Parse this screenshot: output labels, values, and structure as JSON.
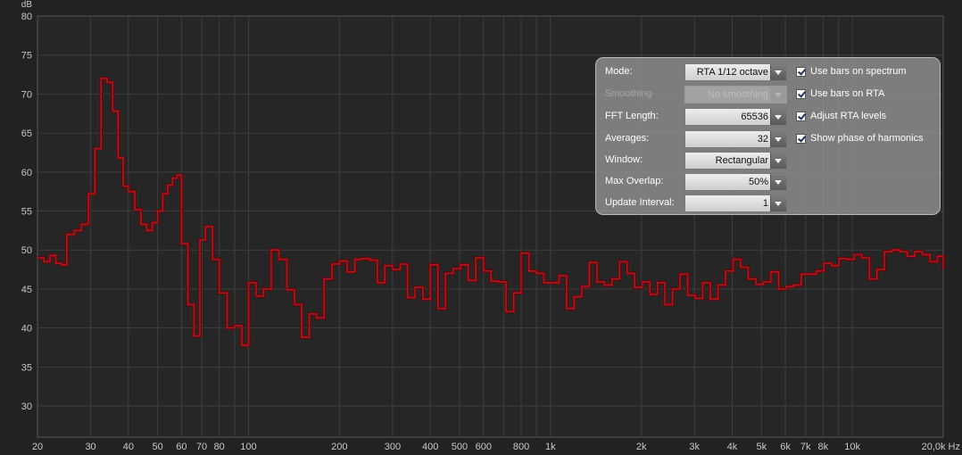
{
  "chart_data": {
    "type": "line",
    "ylabel": "dB",
    "xunit": "Hz",
    "xscale": "log",
    "xlim": [
      20,
      20000
    ],
    "ylim": [
      26,
      80
    ],
    "grid": true,
    "yticks": [
      "30",
      "35",
      "40",
      "45",
      "50",
      "55",
      "60",
      "65",
      "70",
      "75",
      "80"
    ],
    "xticks": [
      {
        "v": 20,
        "label": "20"
      },
      {
        "v": 30,
        "label": "30"
      },
      {
        "v": 40,
        "label": "40"
      },
      {
        "v": 50,
        "label": "50"
      },
      {
        "v": 60,
        "label": "60"
      },
      {
        "v": 70,
        "label": "70"
      },
      {
        "v": 80,
        "label": "80"
      },
      {
        "v": 100,
        "label": "100"
      },
      {
        "v": 200,
        "label": "200"
      },
      {
        "v": 300,
        "label": "300"
      },
      {
        "v": 400,
        "label": "400"
      },
      {
        "v": 500,
        "label": "500"
      },
      {
        "v": 600,
        "label": "600"
      },
      {
        "v": 800,
        "label": "800"
      },
      {
        "v": 1000,
        "label": "1k"
      },
      {
        "v": 2000,
        "label": "2k"
      },
      {
        "v": 3000,
        "label": "3k"
      },
      {
        "v": 4000,
        "label": "4k"
      },
      {
        "v": 5000,
        "label": "5k"
      },
      {
        "v": 6000,
        "label": "6k"
      },
      {
        "v": 7000,
        "label": "7k"
      },
      {
        "v": 8000,
        "label": "8k"
      },
      {
        "v": 10000,
        "label": "10k"
      },
      {
        "v": 20000,
        "label": "20,0k Hz"
      }
    ],
    "series": [
      {
        "color": "#b2161c",
        "points": [
          [
            20,
            49.0
          ],
          [
            21,
            48.5
          ],
          [
            22,
            49.3
          ],
          [
            23,
            48.3
          ],
          [
            24,
            48.1
          ],
          [
            25,
            52.0
          ],
          [
            26.5,
            52.5
          ],
          [
            28,
            53.3
          ],
          [
            29.5,
            57.2
          ],
          [
            31,
            63.0
          ],
          [
            32.5,
            72.0
          ],
          [
            34,
            71.5
          ],
          [
            35.5,
            67.8
          ],
          [
            37,
            61.8
          ],
          [
            38.5,
            58.2
          ],
          [
            40,
            57.5
          ],
          [
            42,
            55.2
          ],
          [
            44,
            53.3
          ],
          [
            46,
            52.5
          ],
          [
            48,
            53.5
          ],
          [
            50,
            55.0
          ],
          [
            52,
            57.2
          ],
          [
            54,
            58.3
          ],
          [
            56,
            59.2
          ],
          [
            58,
            59.6
          ],
          [
            60,
            50.8
          ],
          [
            63,
            43.0
          ],
          [
            66,
            39.0
          ],
          [
            69,
            51.3
          ],
          [
            72,
            53.0
          ],
          [
            76,
            48.8
          ],
          [
            80,
            44.5
          ],
          [
            85,
            40.0
          ],
          [
            90,
            40.3
          ],
          [
            95,
            37.8
          ],
          [
            100,
            45.8
          ],
          [
            106,
            44.1
          ],
          [
            112,
            45.0
          ],
          [
            119,
            50.0
          ],
          [
            126,
            48.8
          ],
          [
            134,
            44.9
          ],
          [
            142,
            43.0
          ],
          [
            150,
            38.8
          ],
          [
            159,
            41.8
          ],
          [
            168,
            41.3
          ],
          [
            178,
            46.3
          ],
          [
            189,
            48.2
          ],
          [
            200,
            48.6
          ],
          [
            212,
            47.2
          ],
          [
            225,
            48.8
          ],
          [
            238,
            48.9
          ],
          [
            252,
            48.7
          ],
          [
            267,
            45.8
          ],
          [
            283,
            48.0
          ],
          [
            300,
            47.5
          ],
          [
            318,
            48.2
          ],
          [
            336,
            43.9
          ],
          [
            356,
            45.2
          ],
          [
            378,
            43.7
          ],
          [
            400,
            48.1
          ],
          [
            424,
            42.5
          ],
          [
            449,
            47.0
          ],
          [
            476,
            47.6
          ],
          [
            504,
            48.1
          ],
          [
            534,
            46.1
          ],
          [
            566,
            49.0
          ],
          [
            600,
            47.3
          ],
          [
            636,
            46.0
          ],
          [
            673,
            45.9
          ],
          [
            713,
            42.1
          ],
          [
            756,
            44.5
          ],
          [
            800,
            49.6
          ],
          [
            848,
            47.3
          ],
          [
            898,
            47.0
          ],
          [
            951,
            45.8
          ],
          [
            1008,
            45.8
          ],
          [
            1068,
            46.7
          ],
          [
            1131,
            42.5
          ],
          [
            1198,
            44.0
          ],
          [
            1269,
            45.3
          ],
          [
            1345,
            48.4
          ],
          [
            1425,
            45.9
          ],
          [
            1509,
            45.5
          ],
          [
            1599,
            46.3
          ],
          [
            1694,
            48.5
          ],
          [
            1794,
            47.0
          ],
          [
            1901,
            45.2
          ],
          [
            2014,
            45.9
          ],
          [
            2134,
            44.3
          ],
          [
            2261,
            45.8
          ],
          [
            2395,
            43.0
          ],
          [
            2537,
            45.0
          ],
          [
            2688,
            46.9
          ],
          [
            2848,
            44.2
          ],
          [
            3017,
            43.8
          ],
          [
            3196,
            45.8
          ],
          [
            3386,
            43.7
          ],
          [
            3588,
            45.5
          ],
          [
            3801,
            47.3
          ],
          [
            4027,
            48.8
          ],
          [
            4266,
            47.8
          ],
          [
            4519,
            46.3
          ],
          [
            4788,
            45.6
          ],
          [
            5072,
            45.9
          ],
          [
            5374,
            47.2
          ],
          [
            5693,
            45.0
          ],
          [
            6031,
            45.3
          ],
          [
            6390,
            45.5
          ],
          [
            6770,
            46.9
          ],
          [
            7172,
            46.9
          ],
          [
            7598,
            47.3
          ],
          [
            8050,
            48.3
          ],
          [
            8528,
            48.0
          ],
          [
            9035,
            48.9
          ],
          [
            9572,
            48.8
          ],
          [
            10141,
            49.4
          ],
          [
            10744,
            49.0
          ],
          [
            11383,
            46.3
          ],
          [
            12059,
            47.5
          ],
          [
            12776,
            49.8
          ],
          [
            13535,
            50.0
          ],
          [
            14340,
            49.8
          ],
          [
            15192,
            49.2
          ],
          [
            16095,
            49.8
          ],
          [
            17052,
            49.4
          ],
          [
            18066,
            48.5
          ],
          [
            19140,
            49.2
          ],
          [
            20000,
            47.6
          ]
        ]
      }
    ]
  },
  "panel": {
    "rows": [
      {
        "label": "Mode:",
        "value": "RTA 1/12 octave",
        "disabled": false
      },
      {
        "label": "Smoothing",
        "value": "No smoothing",
        "disabled": true
      },
      {
        "label": "FFT Length:",
        "value": "65536",
        "disabled": false
      },
      {
        "label": "Averages:",
        "value": "32",
        "disabled": false
      },
      {
        "label": "Window:",
        "value": "Rectangular",
        "disabled": false
      },
      {
        "label": "Max Overlap:",
        "value": "50%",
        "disabled": false
      },
      {
        "label": "Update Interval:",
        "value": "1",
        "disabled": false
      }
    ],
    "checkboxes": [
      {
        "label": "Use bars on spectrum",
        "checked": true
      },
      {
        "label": "Use bars on RTA",
        "checked": true
      },
      {
        "label": "Adjust RTA levels",
        "checked": true
      },
      {
        "label": "Show phase of harmonics",
        "checked": true
      }
    ]
  }
}
